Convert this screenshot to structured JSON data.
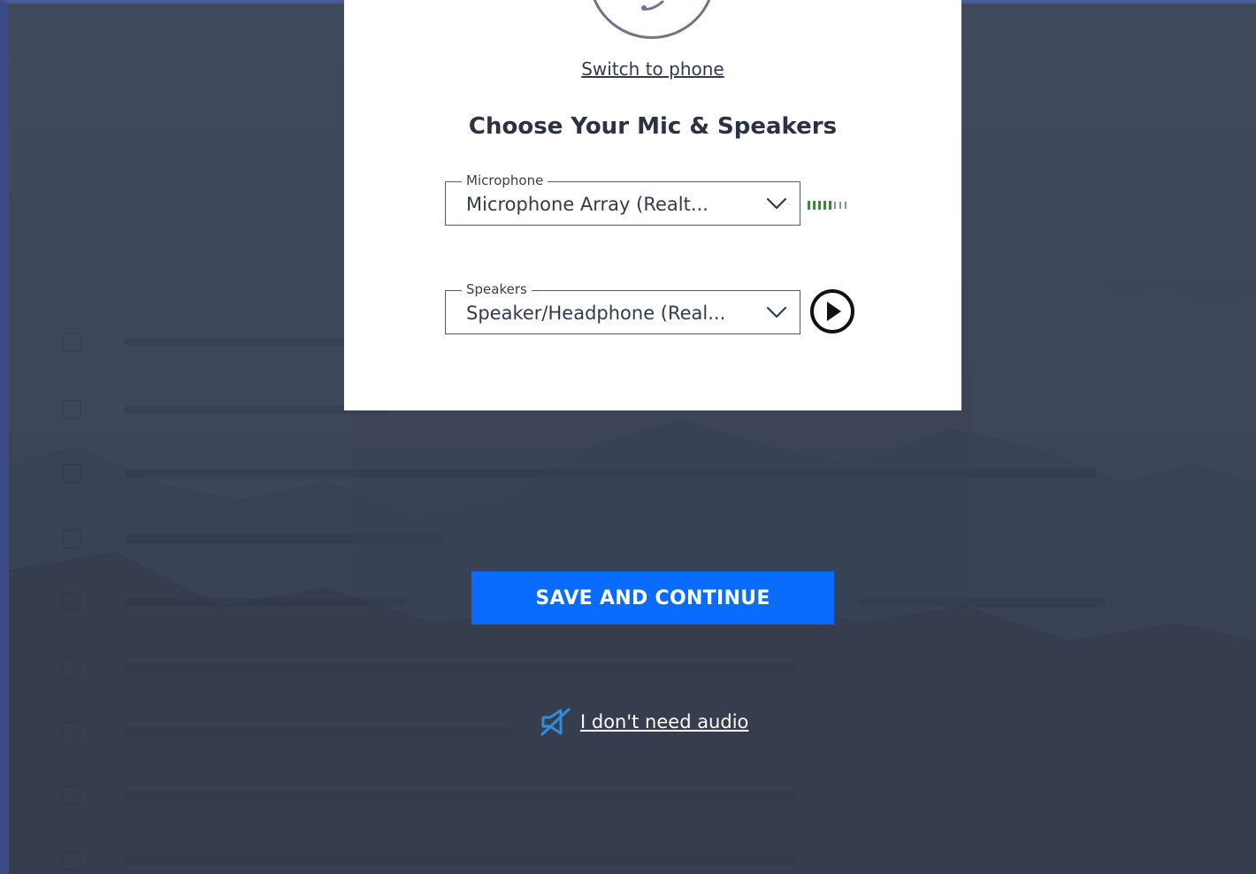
{
  "dialog": {
    "switch_link": "Switch to phone",
    "title": "Choose Your Mic & Speakers",
    "microphone": {
      "label": "Microphone",
      "value": "Microphone Array (Realt..."
    },
    "mic_level": {
      "active_bars": 5,
      "total_bars": 8
    },
    "speakers": {
      "label": "Speakers",
      "value": "Speaker/Headphone (Real..."
    }
  },
  "actions": {
    "save_label": "SAVE AND CONTINUE",
    "no_audio_label": "I don't need audio"
  },
  "icons": {
    "headset": "headset-icon",
    "chevron": "chevron-down-icon",
    "play": "play-icon",
    "no_audio": "speaker-muted-icon"
  },
  "colors": {
    "primary": "#0a6cff",
    "level_active": "#1a9e2a",
    "level_inactive": "#8a8f98",
    "background": "#3a4356",
    "no_audio_icon": "#2f8fd6"
  }
}
